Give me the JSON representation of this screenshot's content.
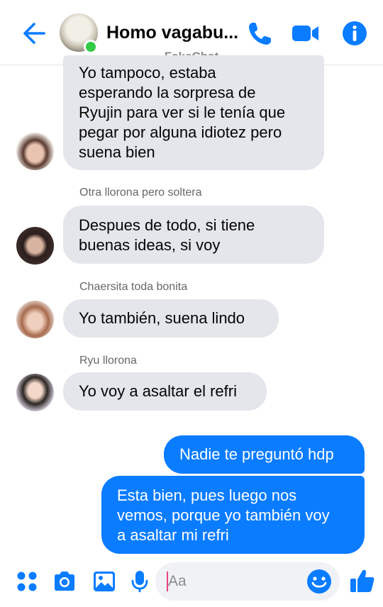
{
  "header": {
    "contact_name": "Homo vagabu...",
    "subtitle": "FakeChat"
  },
  "messages": [
    {
      "type": "incoming",
      "lines": [
        "Yo tampoco, estaba",
        "esperando la sorpresa de",
        "Ryujin para ver si le tenía que",
        "pegar por alguna idiotez pero",
        "suena bien"
      ]
    },
    {
      "type": "incoming",
      "sender": "Otra llorona pero soltera",
      "lines": [
        "Despues de todo, si tiene",
        "buenas ideas, si voy"
      ]
    },
    {
      "type": "incoming",
      "sender": "Chaersita toda bonita",
      "lines": [
        "Yo también, suena lindo"
      ]
    },
    {
      "type": "incoming",
      "sender": "Ryu llorona",
      "lines": [
        "Yo voy a asaltar el refri"
      ]
    },
    {
      "type": "outgoing",
      "lines": [
        "Nadie te preguntó hdp"
      ]
    },
    {
      "type": "outgoing",
      "lines": [
        "Esta bien, pues luego nos",
        "vemos, porque yo también voy",
        "a asaltar mi refri"
      ]
    }
  ],
  "composer": {
    "placeholder": "Aa"
  },
  "colors": {
    "accent": "#0a7cff",
    "incoming_bubble": "#e4e6eb",
    "online": "#31cc46"
  },
  "icons": [
    "back-arrow-icon",
    "phone-icon",
    "video-camera-icon",
    "info-icon",
    "apps-grid-icon",
    "camera-icon",
    "gallery-icon",
    "microphone-icon",
    "emoji-icon",
    "thumbs-up-icon"
  ]
}
